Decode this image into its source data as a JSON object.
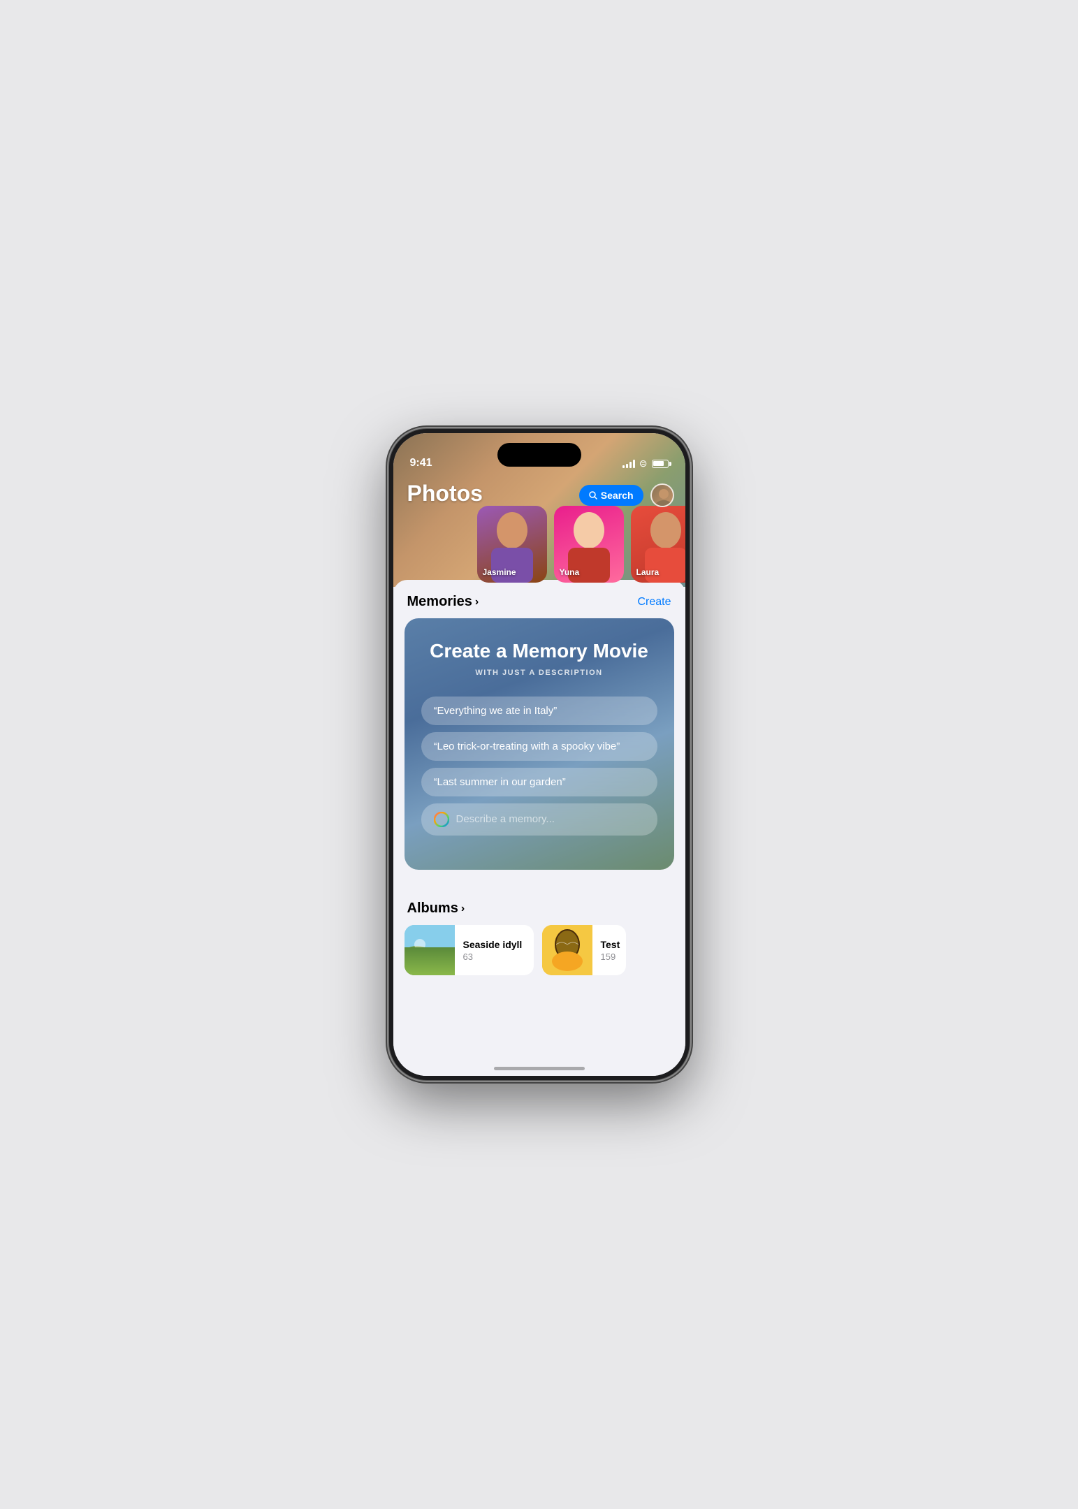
{
  "phone": {
    "status_bar": {
      "time": "9:41"
    }
  },
  "header": {
    "title": "Photos",
    "search_label": "Search",
    "people": [
      {
        "name": "Jasmine",
        "color_start": "#9b59b6",
        "color_end": "#8b4513"
      },
      {
        "name": "Yuna",
        "color_start": "#e91e8c",
        "color_end": "#ff6b9d"
      },
      {
        "name": "Laura",
        "color_start": "#e74c3c",
        "color_end": "#c0392b"
      }
    ]
  },
  "memories": {
    "section_title": "Memories",
    "section_action": "Create",
    "card": {
      "title": "Create a Memory Movie",
      "subtitle": "WITH JUST A DESCRIPTION",
      "suggestions": [
        "“Everything we ate in Italy”",
        "“Leo trick-or-treating with a spooky vibe”",
        "“Last summer in our garden”"
      ],
      "input_placeholder": "Describe a memory..."
    }
  },
  "albums": {
    "section_title": "Albums",
    "items": [
      {
        "name": "Seaside idyll",
        "count": "63"
      },
      {
        "name": "Test",
        "count": "159"
      }
    ]
  }
}
